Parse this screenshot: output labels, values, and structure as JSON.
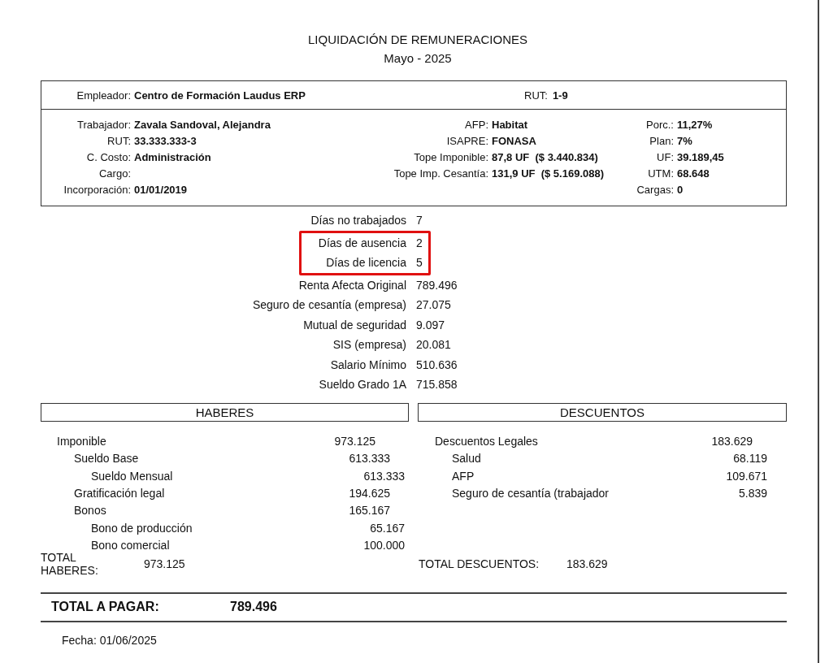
{
  "title": "LIQUIDACIÓN DE REMUNERACIONES",
  "period": "Mayo - 2025",
  "employer": {
    "label": "Empleador:",
    "value": "Centro de Formación Laudus ERP",
    "rut_label": "RUT:",
    "rut_value": "1-9"
  },
  "worker_rows": [
    {
      "left": {
        "label": "Trabajador:",
        "value": "Zavala Sandoval, Alejandra"
      },
      "middle": {
        "label": "AFP:",
        "value": "Habitat"
      },
      "right": {
        "label": "Porc.:",
        "value": "11,27%"
      }
    },
    {
      "left": {
        "label": "RUT:",
        "value": "33.333.333-3"
      },
      "middle": {
        "label": "ISAPRE:",
        "value": "FONASA"
      },
      "right": {
        "label": "Plan:",
        "value": "7%"
      }
    },
    {
      "left": {
        "label": "C. Costo:",
        "value": "Administración"
      },
      "middle": {
        "label": "Tope Imponible:",
        "value": "87,8 UF  ($ 3.440.834)"
      },
      "right": {
        "label": "UF:",
        "value": "39.189,45"
      }
    },
    {
      "left": {
        "label": "Cargo:"
      },
      "middle": {
        "label": "Tope Imp. Cesantía:",
        "value": "131,9 UF  ($ 5.169.088)"
      },
      "right": {
        "label": "UTM:",
        "value": "68.648"
      }
    },
    {
      "left": {
        "label": "Incorporación:",
        "value": "01/01/2019"
      },
      "right": {
        "label": "Cargas:",
        "value": "0"
      }
    }
  ],
  "stats": [
    {
      "label": "Días no trabajados",
      "value": "7",
      "highlighted": false
    },
    {
      "label": "Días de ausencia",
      "value": "2",
      "highlighted": true
    },
    {
      "label": "Días de licencia",
      "value": "5",
      "highlighted": true
    },
    {
      "label": "Renta Afecta Original",
      "value": "789.496",
      "highlighted": false
    },
    {
      "label": "Seguro de cesantía (empresa)",
      "value": "27.075",
      "highlighted": false
    },
    {
      "label": "Mutual de seguridad",
      "value": "9.097",
      "highlighted": false
    },
    {
      "label": "SIS (empresa)",
      "value": "20.081",
      "highlighted": false
    },
    {
      "label": "Salario Mínimo",
      "value": "510.636",
      "highlighted": false
    },
    {
      "label": "Sueldo Grado 1A",
      "value": "715.858",
      "highlighted": false
    }
  ],
  "haberes": {
    "title": "HABERES",
    "items": [
      {
        "label": "Imponible",
        "value": "973.125",
        "children": [
          {
            "label": "Sueldo Base",
            "value": "613.333",
            "children": [
              {
                "label": "Sueldo Mensual",
                "value": "613.333"
              }
            ]
          },
          {
            "label": "Gratificación legal",
            "value": "194.625"
          },
          {
            "label": "Bonos",
            "value": "165.167",
            "children": [
              {
                "label": "Bono de producción",
                "value": "65.167"
              },
              {
                "label": "Bono comercial",
                "value": "100.000"
              }
            ]
          }
        ]
      }
    ],
    "total_label": "TOTAL HABERES:",
    "total_value": "973.125"
  },
  "descuentos": {
    "title": "DESCUENTOS",
    "items": [
      {
        "label": "Descuentos Legales",
        "value": "183.629",
        "children": [
          {
            "label": "Salud",
            "value": "68.119"
          },
          {
            "label": "AFP",
            "value": "109.671"
          },
          {
            "label": "Seguro de cesantía (trabajador",
            "value": "5.839"
          }
        ]
      }
    ],
    "total_label": "TOTAL DESCUENTOS:",
    "total_value": "183.629"
  },
  "total": {
    "label": "TOTAL A PAGAR:",
    "value": "789.496"
  },
  "date": "Fecha: 01/06/2025"
}
